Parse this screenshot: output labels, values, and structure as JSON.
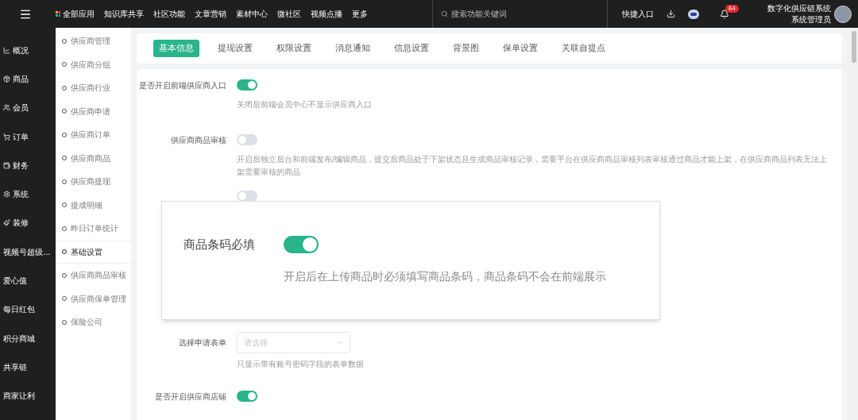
{
  "topbar": {
    "menu_items": [
      {
        "label": "全部应用",
        "kind": "apps"
      },
      {
        "label": "知识库共享"
      },
      {
        "label": "社区功能"
      },
      {
        "label": "文章营销"
      },
      {
        "label": "素材中心"
      },
      {
        "label": "微社区"
      },
      {
        "label": "视频点播"
      },
      {
        "label": "更多"
      }
    ],
    "search": {
      "placeholder": "搜索功能关键词"
    },
    "quick_entry": "快捷入口",
    "notification_count": "64",
    "user": {
      "org": "数字化供应链系统",
      "role": "系统管理员"
    }
  },
  "nav": [
    {
      "label": "概况"
    },
    {
      "label": "商品"
    },
    {
      "label": "会员"
    },
    {
      "label": "订单"
    },
    {
      "label": "财务"
    },
    {
      "label": "系统"
    },
    {
      "label": "装修"
    },
    {
      "label": "视频号超级..."
    },
    {
      "label": "爱心值"
    },
    {
      "label": "每日红包"
    },
    {
      "label": "积分商城"
    },
    {
      "label": "共享链"
    },
    {
      "label": "商家让利"
    }
  ],
  "submenu": [
    {
      "label": "供应商管理",
      "selected": false
    },
    {
      "label": "供应商分组",
      "selected": false
    },
    {
      "label": "供应商行业",
      "selected": false
    },
    {
      "label": "供应商申请",
      "selected": false
    },
    {
      "label": "供应商订单",
      "selected": false
    },
    {
      "label": "供应商商品",
      "selected": false
    },
    {
      "label": "供应商提现",
      "selected": false
    },
    {
      "label": "提成明细",
      "selected": false
    },
    {
      "label": "昨日订单统计",
      "selected": false
    },
    {
      "label": "基础设置",
      "selected": true
    },
    {
      "label": "供应商商品审核",
      "selected": false
    },
    {
      "label": "供应商保单管理",
      "selected": false
    },
    {
      "label": "保险公司",
      "selected": false
    }
  ],
  "tabs": [
    {
      "label": "基本信息",
      "selected": true
    },
    {
      "label": "提现设置",
      "selected": false
    },
    {
      "label": "权限设置",
      "selected": false
    },
    {
      "label": "消息通知",
      "selected": false
    },
    {
      "label": "信息设置",
      "selected": false
    },
    {
      "label": "背景图",
      "selected": false
    },
    {
      "label": "保单设置",
      "selected": false
    },
    {
      "label": "关联自提点",
      "selected": false
    }
  ],
  "form": [
    {
      "kind": "toggle",
      "label": "是否开启前端供应商入口",
      "on": true,
      "hint": "关闭后前端会员中心不显示供应商入口"
    },
    {
      "kind": "toggle",
      "label": "供应商商品审核",
      "on": false,
      "hint": "开启后独立后台和前端发布/编辑商品，提交后商品处于下架状态且生成商品审核记录，需要平台在供应商商品审核列表审核通过商品才能上架，在供应商商品列表无法上架需要审核的商品"
    },
    {
      "kind": "toggle",
      "on": false
    },
    {
      "kind": "select",
      "label": "选择申请表单",
      "placeholder": "请选择",
      "hint": "只显示带有账号密码字段的表单数据"
    },
    {
      "kind": "toggle",
      "label": "是否开启供应商店铺",
      "on": true
    }
  ],
  "popup": {
    "label": "商品条码必填",
    "on": true,
    "hint": "开启后在上传商品时必须填写商品条码，商品条码不会在前端展示"
  }
}
